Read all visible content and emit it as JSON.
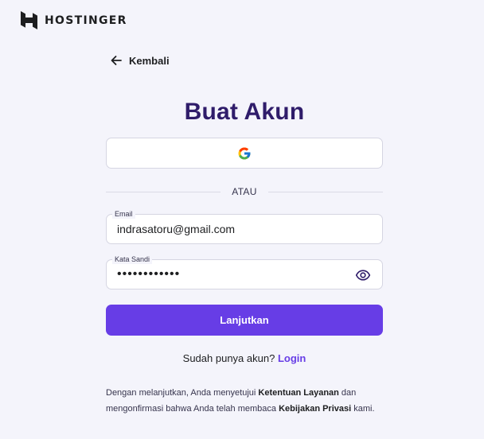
{
  "brand": {
    "name": "HOSTINGER",
    "icon": "hostinger-logo"
  },
  "nav": {
    "back_label": "Kembali",
    "back_icon": "arrow-left-icon"
  },
  "page": {
    "title": "Buat Akun"
  },
  "google_button": {
    "icon": "google-icon"
  },
  "divider": {
    "text": "ATAU"
  },
  "form": {
    "email": {
      "label": "Email",
      "value": "indrasatoru@gmail.com"
    },
    "password": {
      "label": "Kata Sandi",
      "value": "••••••••••••",
      "toggle_icon": "eye-icon"
    },
    "submit_label": "Lanjutkan"
  },
  "login": {
    "prompt": "Sudah punya akun?",
    "link": "Login"
  },
  "terms": {
    "part1": "Dengan melanjutkan, Anda menyetujui ",
    "link1": "Ketentuan Layanan",
    "part2": " dan mengonfirmasi bahwa Anda telah membaca ",
    "link2": "Kebijakan Privasi",
    "part3": " kami."
  },
  "colors": {
    "background": "#f4f4fb",
    "primary": "#673de6",
    "title": "#2f1c6a",
    "text": "#1d1e20"
  }
}
